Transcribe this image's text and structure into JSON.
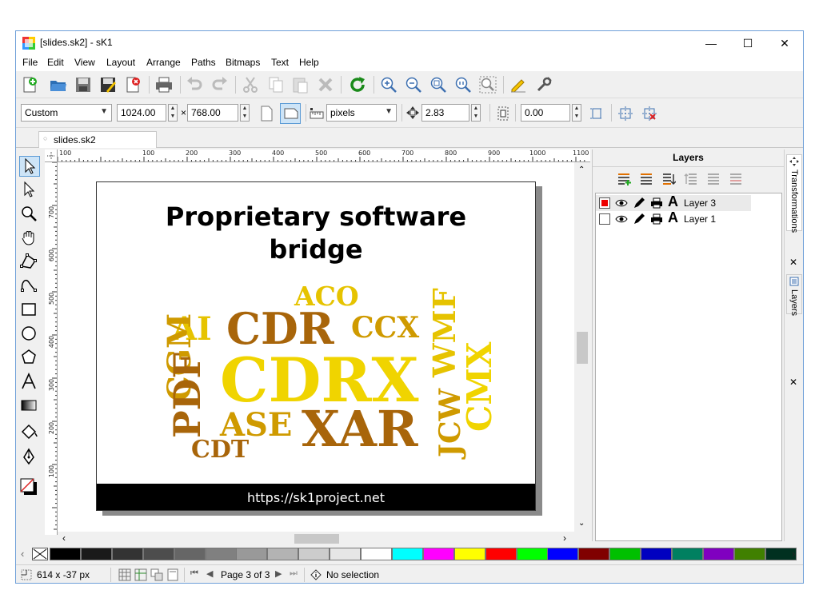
{
  "window": {
    "title": "[slides.sk2] - sK1",
    "minimize": "—",
    "maximize": "☐",
    "close": "✕"
  },
  "menu": [
    "File",
    "Edit",
    "View",
    "Layout",
    "Arrange",
    "Paths",
    "Bitmaps",
    "Text",
    "Help"
  ],
  "toolbar1": {
    "icons": [
      "new-document-icon",
      "open-icon",
      "save-icon",
      "save-as-icon",
      "close-document-icon",
      "print-icon",
      "undo-icon",
      "redo-icon",
      "cut-icon",
      "copy-icon",
      "paste-icon",
      "delete-icon",
      "refresh-icon",
      "zoom-in-icon",
      "zoom-out-icon",
      "zoom-page-icon",
      "zoom-100-icon",
      "zoom-selection-icon",
      "pencil-ruler-icon",
      "settings-icon"
    ]
  },
  "toolbar2": {
    "page_format": "Custom",
    "width": "1024.00",
    "times": "×",
    "height": "768.00",
    "units": "pixels",
    "jump": "2.83",
    "rotation": "0.00"
  },
  "doc_tab": {
    "label": "slides.sk2"
  },
  "rulers": {
    "top": [
      "100",
      "100",
      "200",
      "300",
      "400",
      "500",
      "600",
      "700",
      "800",
      "900",
      "1000",
      "1100"
    ],
    "left": [
      "700",
      "600",
      "500",
      "400",
      "300",
      "200",
      "100"
    ]
  },
  "slide": {
    "title_line1": "Proprietary software",
    "title_line2": "bridge",
    "footer": "https://sk1project.net",
    "words": [
      {
        "text": "ACO",
        "color": "#e6c300"
      },
      {
        "text": "AI",
        "color": "#e6c300"
      },
      {
        "text": "CDR",
        "color": "#a8650a"
      },
      {
        "text": "CCX",
        "color": "#cf9a00"
      },
      {
        "text": "CGM",
        "color": "#cf9a00"
      },
      {
        "text": "PDF",
        "color": "#a8650a"
      },
      {
        "text": "CDRX",
        "color": "#f0d400"
      },
      {
        "text": "ASE",
        "color": "#cf9a00"
      },
      {
        "text": "XAR",
        "color": "#a8650a"
      },
      {
        "text": "CDT",
        "color": "#a8650a"
      },
      {
        "text": "WMF",
        "color": "#e6c300"
      },
      {
        "text": "JCW",
        "color": "#cf9a00"
      },
      {
        "text": "CMX",
        "color": "#f0d400"
      }
    ]
  },
  "layers": {
    "header": "Layers",
    "items": [
      {
        "name": "Layer 3",
        "active": true
      },
      {
        "name": "Layer 1",
        "active": false
      }
    ]
  },
  "side_tabs": {
    "transformations": "Transformations",
    "layers": "Layers"
  },
  "palette": [
    "#000000",
    "#1a1a1a",
    "#333333",
    "#4d4d4d",
    "#666666",
    "#808080",
    "#999999",
    "#b3b3b3",
    "#cccccc",
    "#e6e6e6",
    "#ffffff",
    "#00ffff",
    "#ff00ff",
    "#ffff00",
    "#ff0000",
    "#00ff00",
    "#0000ff",
    "#800000",
    "#00c000",
    "#0000c0",
    "#008060",
    "#8000c0",
    "#408000",
    "#003020"
  ],
  "status": {
    "coords": "614 x -37 px",
    "page": "Page 3 of 3",
    "selection": "No selection"
  }
}
